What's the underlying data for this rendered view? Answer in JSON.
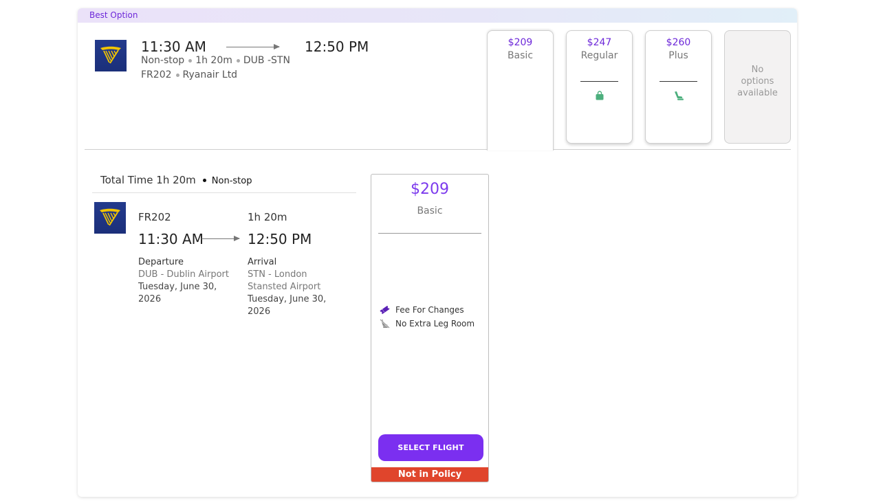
{
  "banner": {
    "label": "Best Option"
  },
  "summary": {
    "depart_time": "11:30 AM",
    "arrive_time": "12:50 PM",
    "stops": "Non-stop",
    "duration": "1h 20m",
    "route": "DUB -STN",
    "flight_no": "FR202",
    "airline": "Ryanair Ltd",
    "logo_icon": "ryanair-harp-logo"
  },
  "fares": [
    {
      "price": "$209",
      "name": "Basic",
      "icon": "",
      "selected": true
    },
    {
      "price": "$247",
      "name": "Regular",
      "icon": "bag-icon"
    },
    {
      "price": "$260",
      "name": "Plus",
      "icon": "seat-icon"
    },
    {
      "na_line1": "No",
      "na_line2": "options",
      "na_line3": "available"
    }
  ],
  "details": {
    "total_label": "Total Time 1h 20m",
    "stops": "Non-stop",
    "flight_no": "FR202",
    "duration": "1h 20m",
    "depart_time": "11:30 AM",
    "arrive_time": "12:50 PM",
    "departure": {
      "label": "Departure",
      "airport": "DUB - Dublin Airport",
      "date_line1": "Tuesday, June 30,",
      "date_line2": "2026"
    },
    "arrival": {
      "label": "Arrival",
      "airport_line1": "STN - London",
      "airport_line2": "Stansted Airport",
      "date_line1": "Tuesday, June 30,",
      "date_line2": "2026"
    }
  },
  "selected_fare": {
    "price": "$209",
    "name": "Basic",
    "features": [
      {
        "label": "Fee For Changes",
        "icon": "ticket-icon"
      },
      {
        "label": "No Extra Leg Room",
        "icon": "seat-crossed-icon"
      }
    ],
    "button": "SELECT FLIGHT",
    "policy": "Not in Policy"
  },
  "colors": {
    "accent": "#7b2ff0",
    "price": "#6d28d9",
    "policy": "#e0452c",
    "amenity": "#4caf7d"
  }
}
